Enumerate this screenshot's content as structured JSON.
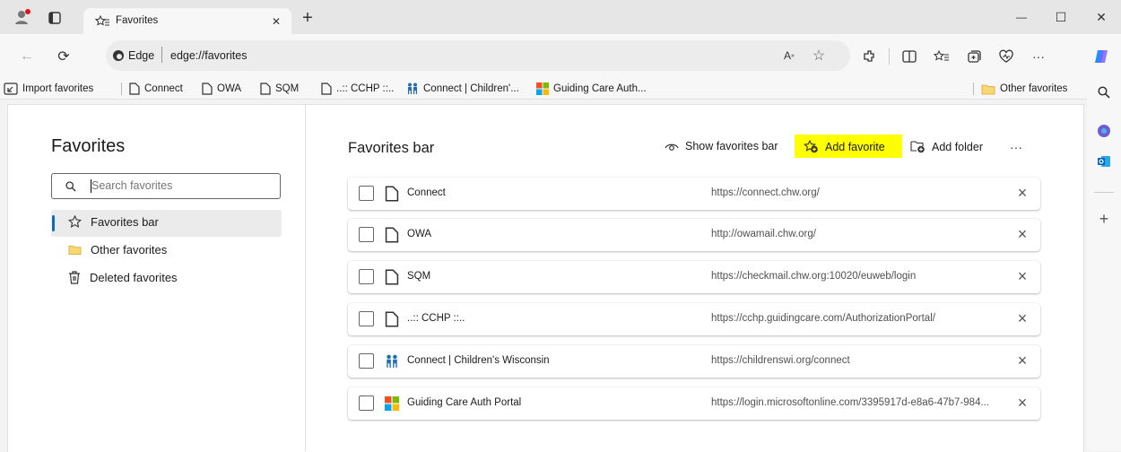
{
  "window": {
    "tab_title": "Favorites",
    "minimize_glyph": "—",
    "restore_glyph": "☐",
    "close_glyph": "✕",
    "new_tab_glyph": "+"
  },
  "address_bar": {
    "site_label": "Edge",
    "url": "edge://favorites"
  },
  "bookmarks_bar": {
    "import": "Import favorites",
    "items": [
      "Connect",
      "OWA",
      "SQM",
      "..:: CCHP ::..",
      "Connect | Children'...",
      "Guiding Care Auth..."
    ],
    "other": "Other favorites"
  },
  "left_pane": {
    "title": "Favorites",
    "search_placeholder": "Search favorites",
    "nav": [
      "Favorites bar",
      "Other favorites",
      "Deleted favorites"
    ]
  },
  "main": {
    "title": "Favorites bar",
    "show_bar": "Show favorites bar",
    "add_favorite": "Add favorite",
    "add_folder": "Add folder",
    "more": "···",
    "highlight_color": "#ffff00",
    "rows": [
      {
        "name": "Connect",
        "url": "https://connect.chw.org/",
        "icon": "page-icon"
      },
      {
        "name": "OWA",
        "url": "http://owamail.chw.org/",
        "icon": "page-icon"
      },
      {
        "name": "SQM",
        "url": "https://checkmail.chw.org:10020/euweb/login",
        "icon": "page-icon"
      },
      {
        "name": "..:: CCHP ::..",
        "url": "https://cchp.guidingcare.com/AuthorizationPortal/",
        "icon": "page-icon"
      },
      {
        "name": "Connect | Children's Wisconsin",
        "url": "https://childrenswi.org/connect",
        "icon": "people-icon"
      },
      {
        "name": "Guiding Care Auth Portal",
        "url": "https://login.microsoftonline.com/3395917d-e8a6-47b7-984...",
        "icon": "microsoft-icon"
      }
    ]
  }
}
